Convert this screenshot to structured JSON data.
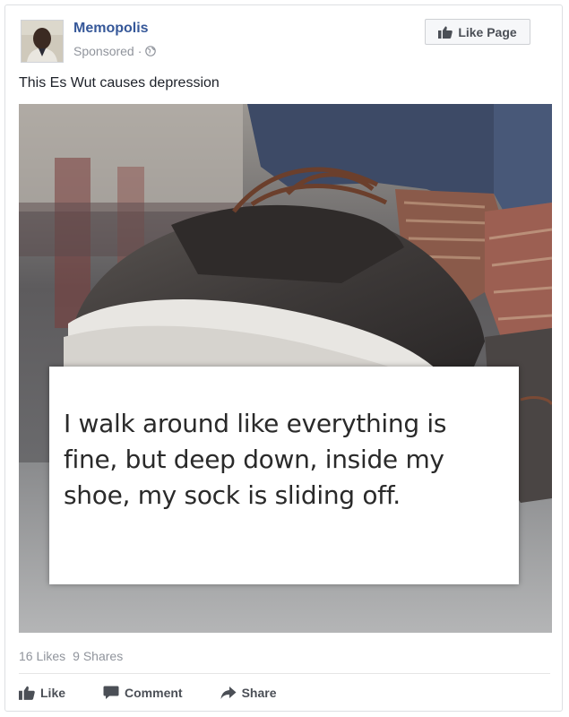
{
  "post": {
    "page_name": "Memopolis",
    "meta": {
      "sponsored": "Sponsored",
      "separator": "·",
      "privacy_icon": "globe-icon"
    },
    "like_page_label": "Like Page",
    "caption": "This Es Wut causes depression",
    "image": {
      "quote_text": "I walk around like everything is fine, but deep down, inside my shoe, my sock is sliding off."
    },
    "stats": {
      "likes": "16 Likes",
      "shares": "9 Shares"
    },
    "actions": {
      "like": "Like",
      "comment": "Comment",
      "share": "Share"
    }
  },
  "colors": {
    "link_blue": "#365899",
    "action_gray": "#4b4f56",
    "meta_gray": "#90949c"
  }
}
